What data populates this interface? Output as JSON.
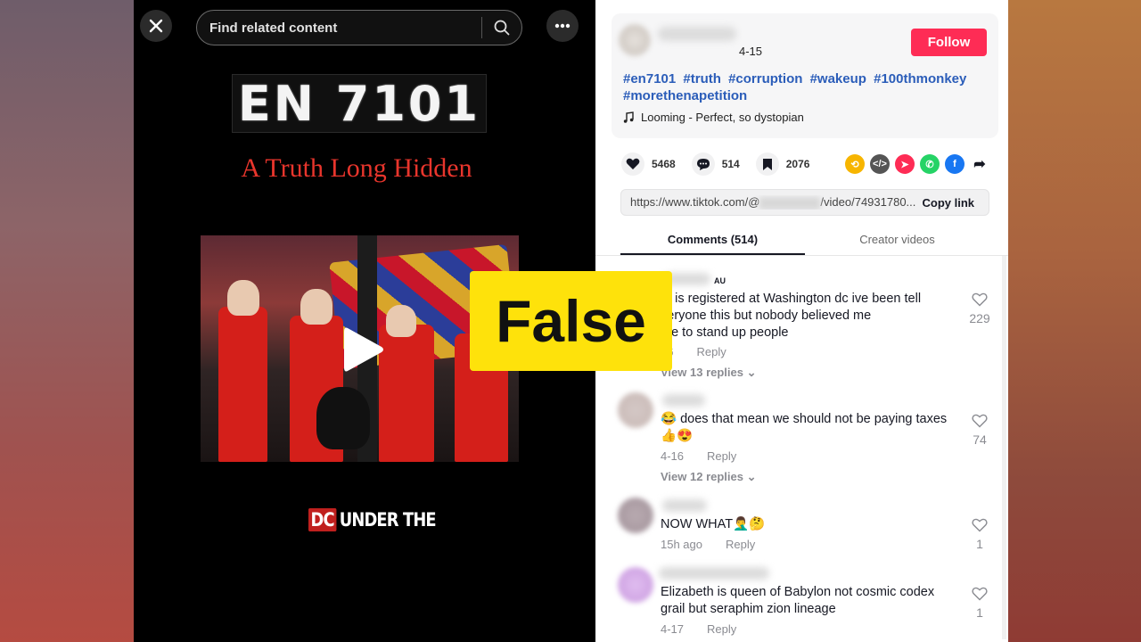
{
  "search": {
    "placeholder": "Find related content"
  },
  "video": {
    "title_card": "EN 7101",
    "subtitle": "A Truth Long Hidden",
    "logo_mark": "DC",
    "logo_text": "UNDER THE"
  },
  "post": {
    "date": "4-15",
    "follow_label": "Follow",
    "hashtags": [
      "#en7101",
      "#truth",
      "#corruption",
      "#wakeup",
      "#100thmonkey",
      "#morethenapetition"
    ],
    "music": "Looming - Perfect, so dystopian",
    "likes": "5468",
    "comments": "514",
    "saves": "2076",
    "link_prefix": "https://www.tiktok.com/@",
    "link_suffix": "/video/74931780...",
    "copy_label": "Copy link"
  },
  "tabs": {
    "comments": "Comments (514)",
    "creator": "Creator videos"
  },
  "comments": [
    {
      "country": "AU",
      "line1": "to is registered at Washington dc ive been tell",
      "line2": "veryone this but nobody believed me",
      "line3": "me to stand up people",
      "date": "16",
      "reply": "Reply",
      "likes": "229",
      "replies": "View 13 replies"
    },
    {
      "line1": "😂 does that mean we should not be paying taxes",
      "line2": "👍😍",
      "date": "4-16",
      "reply": "Reply",
      "likes": "74",
      "replies": "View 12 replies"
    },
    {
      "line1": "NOW WHAT🤦‍♂️🤔",
      "date": "15h ago",
      "reply": "Reply",
      "likes": "1"
    },
    {
      "line1": "Elizabeth is queen of Babylon not cosmic codex",
      "line2": "grail but seraphim zion lineage",
      "date": "4-17",
      "reply": "Reply",
      "likes": "1"
    }
  ],
  "overlay": {
    "verdict": "False",
    "color": "#fee20b"
  },
  "colors": {
    "follow": "#fe2c55",
    "hashtag": "#2b5db9",
    "subtitle": "#e8352c"
  }
}
